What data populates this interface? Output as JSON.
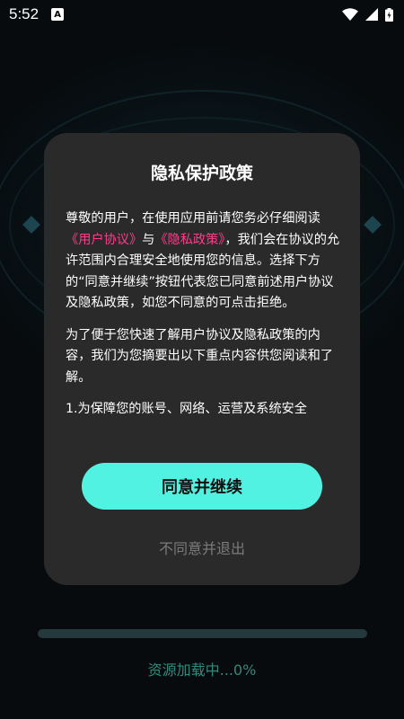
{
  "status_bar": {
    "time": "5:52",
    "notification_icon_letter": "A",
    "icons": [
      "wifi-icon",
      "signal-icon",
      "battery-icon"
    ]
  },
  "dialog": {
    "title": "隐私保护政策",
    "para1_intro": "尊敬的用户，在使用应用前请您务必仔细阅读",
    "link_user_agreement": "《用户协议》",
    "para1_and": "与",
    "link_privacy_policy": "《隐私政策》",
    "para1_rest": "，我们会在协议的允许范围内合理安全地使用您的信息。选择下方的“同意并继续”按钮代表您已同意前述用户协议及隐私政策，如您不同意的可点击拒绝。",
    "para2": " 为了便于您快速了解用户协议及隐私政策的内容，我们为您摘要出以下重点内容供您阅读和了解。",
    "para3": "1.为保障您的账号、网络、运营及系统安全",
    "agree_button": "同意并继续",
    "decline_button": "不同意并退出"
  },
  "loading": {
    "text": "资源加载中...0%",
    "progress": 0
  },
  "colors": {
    "accent": "#52f2e2",
    "link": "#ff3c8c",
    "dialog_bg": "#2a2a2a",
    "loading_text": "#2f8a7d"
  }
}
